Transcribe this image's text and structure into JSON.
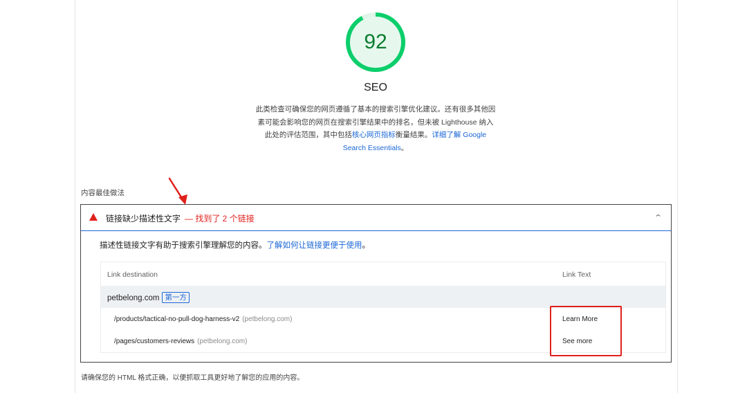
{
  "category": {
    "score": "92",
    "score_fraction": 0.92,
    "title": "SEO",
    "description_line1": "此类检查可确保您的网页遵循了基本的搜索引擎优化建议。还有很多其他因",
    "description_line2": "素可能会影响您的网页在搜索引擎结果中的排名，但未被 Lighthouse 纳入",
    "description_line3_pre": "此处的评估范围，其中包括",
    "description_link1": "核心网页指标",
    "description_line3_mid": "衡量结果。",
    "description_link2_a": "详细了解 Google",
    "description_link2_b": "Search Essentials",
    "description_end": "。",
    "pass_color": "#0cce6b"
  },
  "group": {
    "title": "内容最佳做法"
  },
  "audit": {
    "icon": "fail-triangle-icon",
    "title": "链接缺少描述性文字",
    "found": "— 找到了 2 个链接",
    "chevron": "⌃",
    "description": "描述性链接文字有助于搜索引擎理解您的内容。",
    "learn_link": "了解如何让链接更便于使用",
    "description_end": "。",
    "fail_color": "#e0201b"
  },
  "table": {
    "col_destination": "Link destination",
    "col_text": "Link Text",
    "entity": "petbelong.com",
    "entity_badge": "第一方",
    "rows": [
      {
        "path": "/products/tactical-no-pull-dog-harness-v2",
        "host": "(petbelong.com)",
        "text": "Learn More"
      },
      {
        "path": "/pages/customers-reviews",
        "host": "(petbelong.com)",
        "text": "See more"
      }
    ]
  },
  "footer": {
    "next_audit_desc": "请确保您的 HTML 格式正确，以便抓取工具更好地了解您的应用的内容。"
  }
}
